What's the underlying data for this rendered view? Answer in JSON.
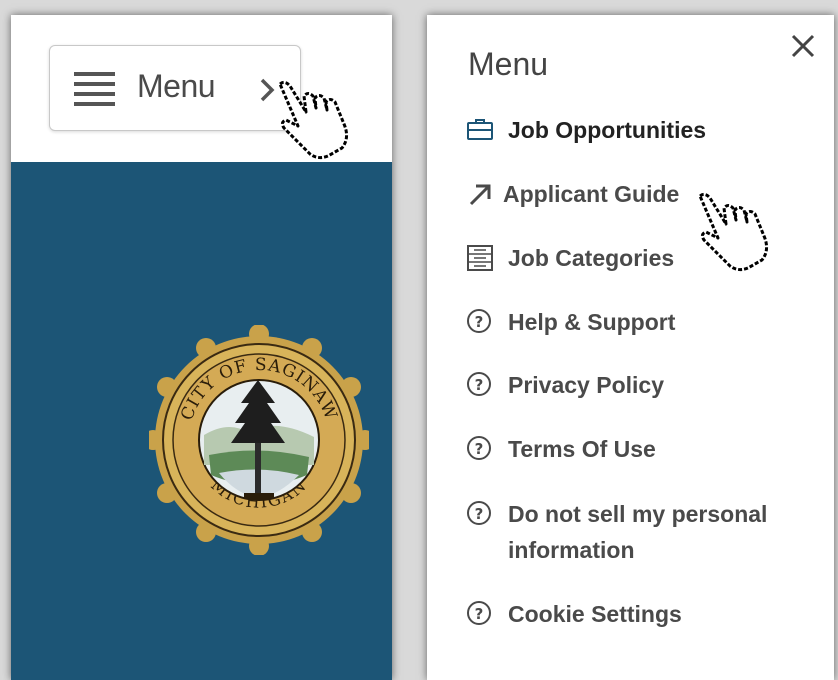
{
  "left": {
    "menu_button": {
      "label": "Menu",
      "icon": "hamburger-icon",
      "chevron": "chevron-right-icon"
    },
    "hero": {
      "background": "#1c5576",
      "seal": "city-seal"
    }
  },
  "right": {
    "title": "Menu",
    "close_icon": "close-icon",
    "items": [
      {
        "label": "Job Opportunities",
        "icon": "briefcase-icon",
        "active": true
      },
      {
        "label": "Applicant Guide",
        "icon": "arrow-up-right-icon"
      },
      {
        "label": "Job Categories",
        "icon": "list-icon"
      },
      {
        "label": "Help & Support",
        "icon": "question-circle-icon"
      },
      {
        "label": "Privacy Policy",
        "icon": "question-circle-icon"
      },
      {
        "label": "Terms Of Use",
        "icon": "question-circle-icon"
      },
      {
        "label": "Do not sell my personal information",
        "icon": "question-circle-icon"
      },
      {
        "label": "Cookie Settings",
        "icon": "question-circle-icon"
      }
    ]
  },
  "colors": {
    "accent": "#1c5576",
    "text": "#4a4a4a",
    "seal_gold": "#c9a24a"
  },
  "seal_text": {
    "top": "CITY OF SAGINAW",
    "bottom": "MICHIGAN"
  }
}
